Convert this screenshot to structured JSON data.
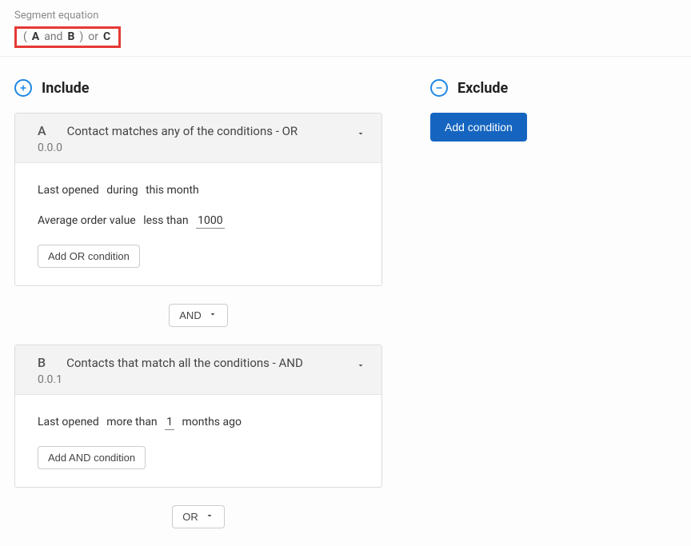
{
  "header": {
    "label": "Segment equation",
    "equation": {
      "lp": "(",
      "a": "A",
      "and": "and",
      "b": "B",
      "rp": ")",
      "or": "or",
      "c": "C"
    }
  },
  "include": {
    "title": "Include",
    "groups": [
      {
        "letter": "A",
        "match_text": "Contact matches any of the conditions - OR",
        "version": "0.0.0",
        "conditions": [
          {
            "field": "Last opened",
            "operator": "during",
            "value": "this month",
            "underline": false
          },
          {
            "field": "Average order value",
            "operator": "less than",
            "value": "1000",
            "underline": true
          }
        ],
        "add_label": "Add OR condition",
        "connector_after": "AND"
      },
      {
        "letter": "B",
        "match_text": "Contacts that match all the conditions - AND",
        "version": "0.0.1",
        "conditions": [
          {
            "field": "Last opened",
            "operator": "more than",
            "value": "1",
            "suffix": "months ago",
            "underline": true
          }
        ],
        "add_label": "Add AND condition",
        "connector_after": "OR"
      }
    ]
  },
  "exclude": {
    "title": "Exclude",
    "add_label": "Add condition"
  }
}
